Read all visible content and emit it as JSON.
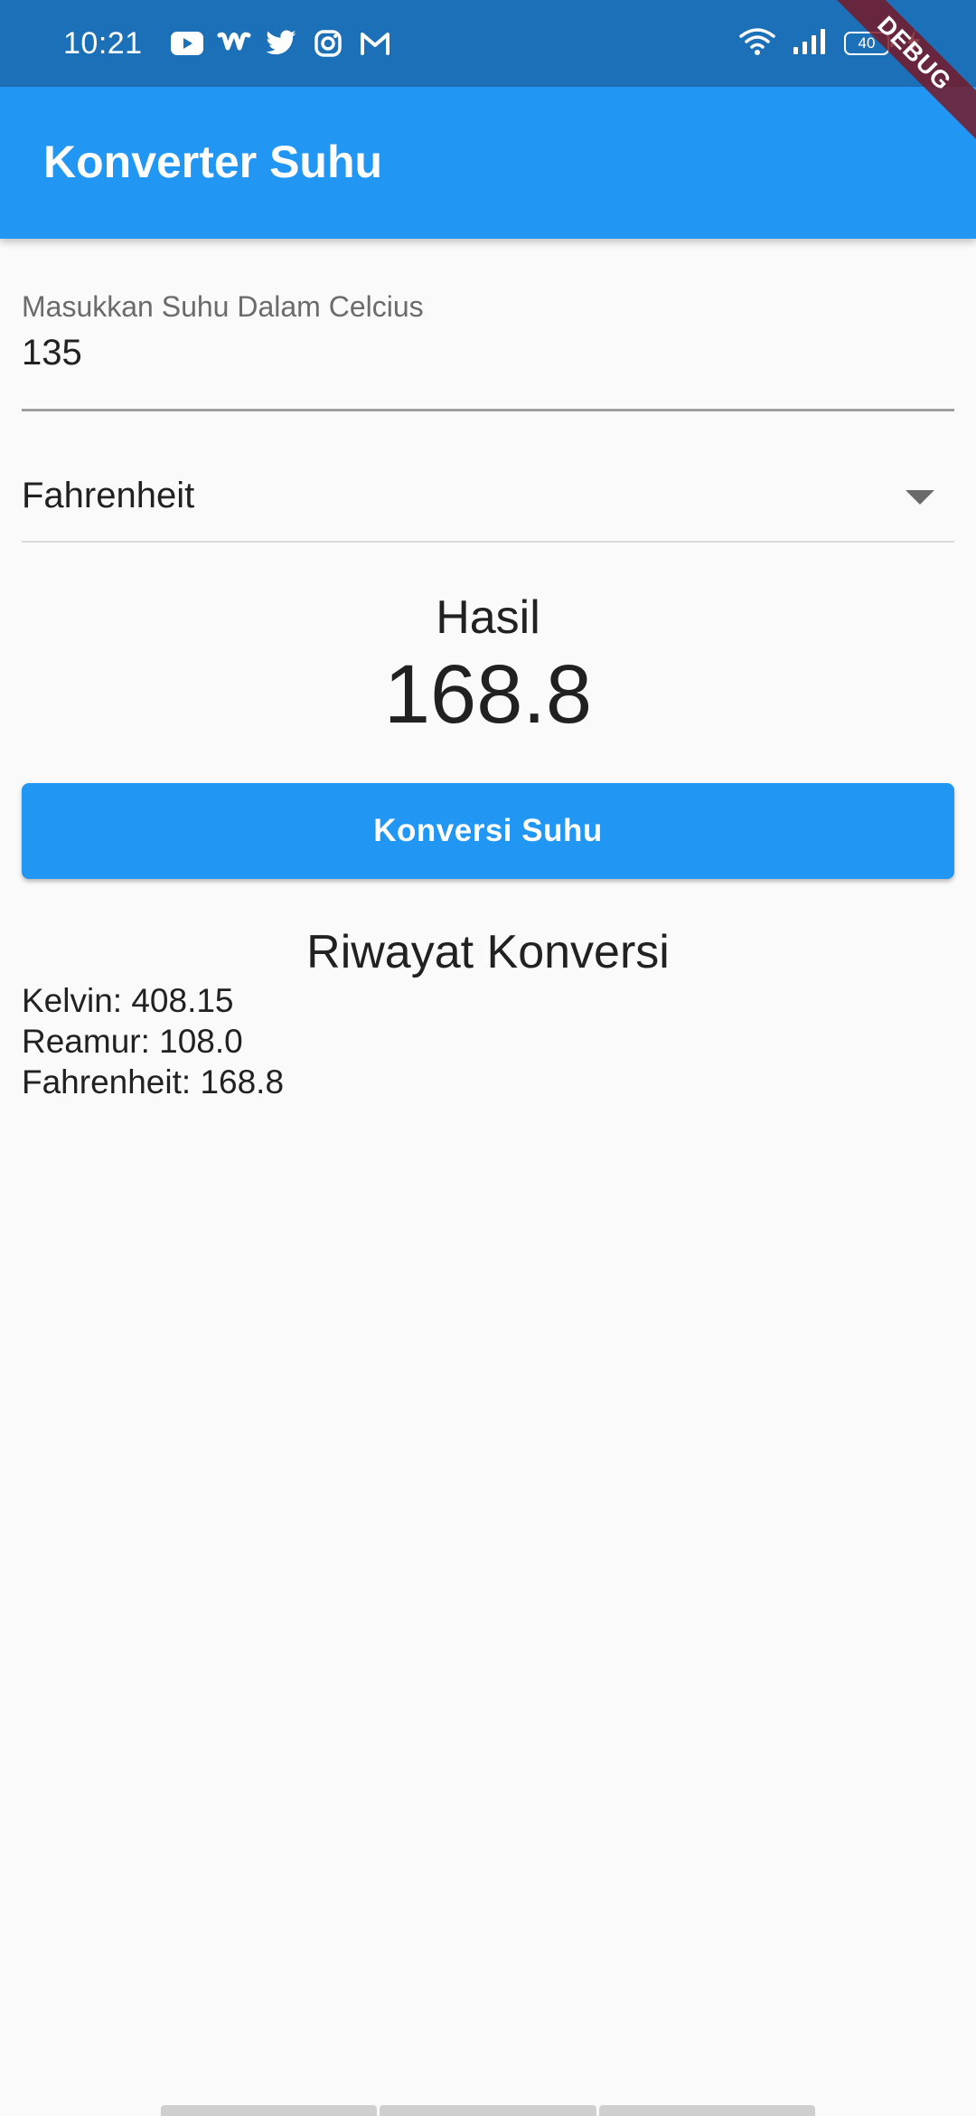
{
  "status_bar": {
    "time": "10:21",
    "app_icons": [
      "youtube-icon",
      "wattpad-icon",
      "twitter-icon",
      "instagram-icon",
      "gmail-icon"
    ],
    "battery_level": "40"
  },
  "debug_banner": {
    "label": "DEBUG"
  },
  "app_bar": {
    "title": "Konverter Suhu"
  },
  "input": {
    "label": "Masukkan Suhu Dalam Celcius",
    "value": "135"
  },
  "dropdown": {
    "selected": "Fahrenheit"
  },
  "result": {
    "label": "Hasil",
    "value": "168.8"
  },
  "convert_button": {
    "label": "Konversi Suhu"
  },
  "history": {
    "title": "Riwayat Konversi",
    "items": [
      "Kelvin: 408.15",
      "Reamur: 108.0",
      "Fahrenheit: 168.8"
    ]
  },
  "colors": {
    "primary": "#2196f3",
    "status_bar": "#1c70b8",
    "background": "#fafafa"
  }
}
